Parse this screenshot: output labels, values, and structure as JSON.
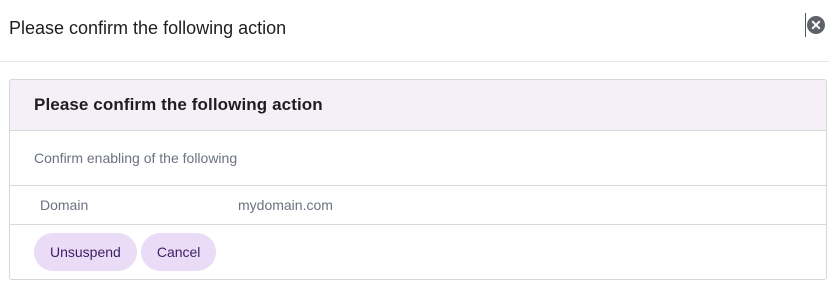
{
  "dialog": {
    "title": "Please confirm the following action",
    "close_icon": "close-circle-icon"
  },
  "card": {
    "header_title": "Please confirm the following action",
    "description": "Confirm enabling of the following",
    "details": [
      {
        "label": "Domain",
        "value": "mydomain.com"
      }
    ]
  },
  "actions": {
    "confirm_label": "Unsuspend",
    "cancel_label": "Cancel"
  },
  "colors": {
    "header_bg": "#f5f0f8",
    "button_bg": "#eadcf7",
    "button_text": "#3b1f63",
    "muted_text": "#6b7280"
  }
}
